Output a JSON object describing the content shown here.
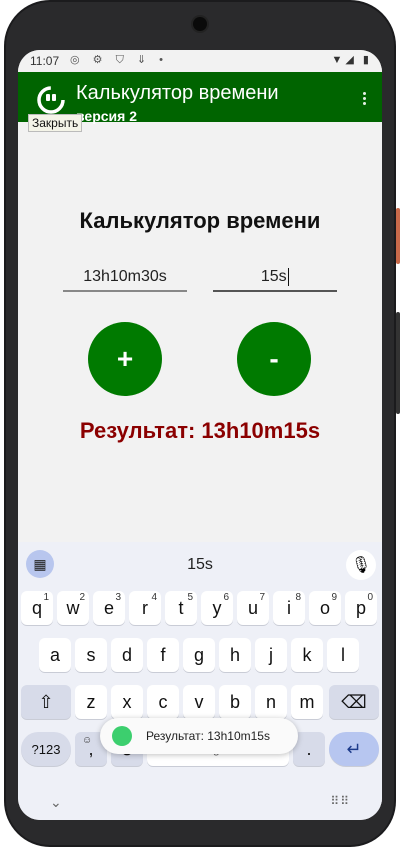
{
  "status_bar": {
    "time": "11:07",
    "left_icons": "◎ ⚙ ⛉ ⇓ •",
    "right_icons": "▼◢ ▮"
  },
  "app_bar": {
    "title": "Калькулятор времени",
    "subtitle": "версия 2",
    "tooltip": "Закрыть",
    "menu_icon": "vertical-dots-icon"
  },
  "main": {
    "heading": "Калькулятор времени",
    "time_input_1": "13h10m30s",
    "time_input_2": "15s",
    "plus_label": "+",
    "minus_label": "-",
    "result": "Результат: 13h10m15s"
  },
  "keyboard": {
    "suggestion": "15s",
    "row1": [
      {
        "k": "q",
        "n": "1"
      },
      {
        "k": "w",
        "n": "2"
      },
      {
        "k": "e",
        "n": "3"
      },
      {
        "k": "r",
        "n": "4"
      },
      {
        "k": "t",
        "n": "5"
      },
      {
        "k": "y",
        "n": "6"
      },
      {
        "k": "u",
        "n": "7"
      },
      {
        "k": "i",
        "n": "8"
      },
      {
        "k": "o",
        "n": "9"
      },
      {
        "k": "p",
        "n": "0"
      }
    ],
    "row2": [
      "a",
      "s",
      "d",
      "f",
      "g",
      "h",
      "j",
      "k",
      "l"
    ],
    "row3": [
      "z",
      "x",
      "c",
      "v",
      "b",
      "n",
      "m"
    ],
    "sym_label": "?123",
    "comma": ",",
    "space_label": "English",
    "period": ".",
    "shift_icon": "⇧",
    "backspace_icon": "⌫",
    "enter_icon": "↵",
    "emoji_icon": "☺",
    "globe_icon": "⊕"
  },
  "toast": "Результат: 13h10m15s",
  "colors": {
    "appbar": "#006400",
    "button": "#007a00",
    "result": "#8b0000"
  }
}
